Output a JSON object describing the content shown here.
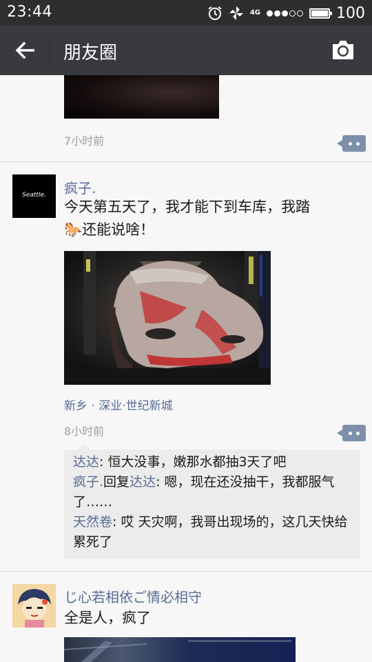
{
  "status_bar": {
    "time": "23:44",
    "network": "4G",
    "signal_level": 3,
    "signal_max": 5,
    "battery": "100",
    "icons": [
      "alarm-icon",
      "pinwheel-icon",
      "battery-icon"
    ]
  },
  "nav": {
    "title": "朋友圈",
    "back_icon": "arrow-left-icon",
    "camera_icon": "camera-icon"
  },
  "feed": {
    "prev_post": {
      "time": "7小时前"
    },
    "post1": {
      "user": "疯子.",
      "avatar_text": "Seattle.",
      "text_line1": "今天第五天了，我才能下到车库，我踏",
      "text_line2": "还能说啥！",
      "emoji": "🐎",
      "location": "新乡 · 深业·世纪新城",
      "time": "8小时前",
      "comments": [
        {
          "name": "达达",
          "sep": ": ",
          "text": "恒大没事，嫩那水都抽3天了吧"
        },
        {
          "name": "疯子.",
          "reply_word": "回复",
          "reply_to": "达达",
          "sep": ": ",
          "text": "嗯，现在还没抽干，我都服气了……"
        },
        {
          "name": "天然卷",
          "sep": ": ",
          "text": "哎 天灾啊，我哥出现场的，这几天快给累死了"
        }
      ]
    },
    "post2": {
      "user": "じ心若相依ご情必相守",
      "text": "全是人，疯了"
    }
  }
}
